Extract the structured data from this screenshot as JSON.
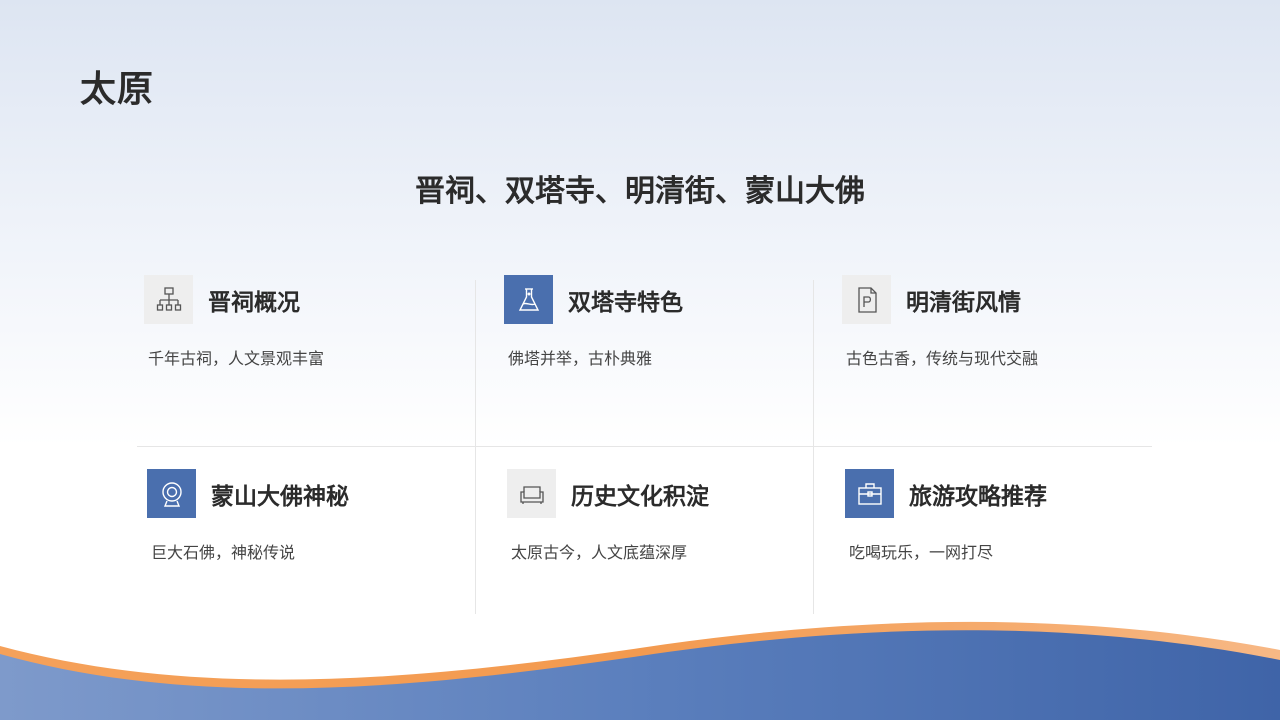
{
  "page": {
    "title": "太原",
    "subtitle": "晋祠、双塔寺、明清街、蒙山大佛"
  },
  "cards": [
    {
      "title": "晋祠概况",
      "desc": "千年古祠，人文景观丰富",
      "icon": "org-chart-icon",
      "style": "light"
    },
    {
      "title": "双塔寺特色",
      "desc": "佛塔并举，古朴典雅",
      "icon": "flask-icon",
      "style": "dark"
    },
    {
      "title": "明清街风情",
      "desc": "古色古香，传统与现代交融",
      "icon": "document-p-icon",
      "style": "light"
    },
    {
      "title": "蒙山大佛神秘",
      "desc": "巨大石佛，神秘传说",
      "icon": "webcam-icon",
      "style": "dark"
    },
    {
      "title": "历史文化积淀",
      "desc": "太原古今，人文底蕴深厚",
      "icon": "sofa-icon",
      "style": "light"
    },
    {
      "title": "旅游攻略推荐",
      "desc": "吃喝玩乐，一网打尽",
      "icon": "briefcase-icon",
      "style": "dark"
    }
  ],
  "colors": {
    "accent_blue": "#4a6fae",
    "accent_orange": "#f0a15c",
    "icon_light_bg": "#eeeeee"
  }
}
